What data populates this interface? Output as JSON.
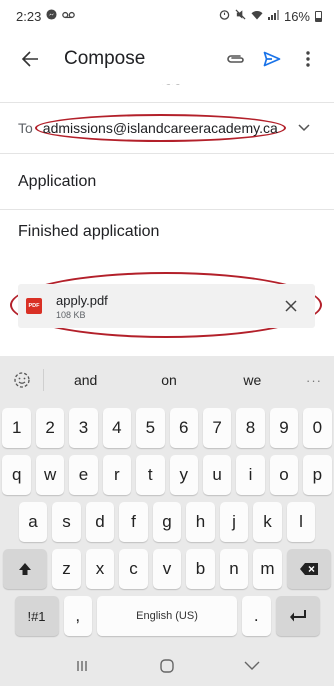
{
  "status_bar": {
    "time": "2:23",
    "battery": "16%"
  },
  "app_bar": {
    "title": "Compose",
    "back_icon": "back-arrow-icon",
    "attach_icon": "paperclip-icon",
    "send_icon": "send-icon",
    "more_icon": "more-vert-icon"
  },
  "compose": {
    "to_label": "To",
    "to_value": "admissions@islandcareeracademy.ca",
    "subject": "Application",
    "body": "Finished application"
  },
  "attachment": {
    "badge": "PDF",
    "name": "apply.pdf",
    "size": "108 KB"
  },
  "keyboard": {
    "suggestions": [
      "and",
      "on",
      "we"
    ],
    "more": "···",
    "rows": [
      [
        "1",
        "2",
        "3",
        "4",
        "5",
        "6",
        "7",
        "8",
        "9",
        "0"
      ],
      [
        "q",
        "w",
        "e",
        "r",
        "t",
        "y",
        "u",
        "i",
        "o",
        "p"
      ],
      [
        "a",
        "s",
        "d",
        "f",
        "g",
        "h",
        "j",
        "k",
        "l"
      ],
      [
        "z",
        "x",
        "c",
        "v",
        "b",
        "n",
        "m"
      ]
    ],
    "symbols_key": "!#1",
    "comma_key": ",",
    "space_label": "English (US)",
    "period_key": ".",
    "colors": {
      "background": "#e9e9e9",
      "key": "#fcfcfc",
      "function_key": "#d6d6d6"
    }
  },
  "annotation_color": "#b3202a",
  "accent_color": "#1a73e8"
}
